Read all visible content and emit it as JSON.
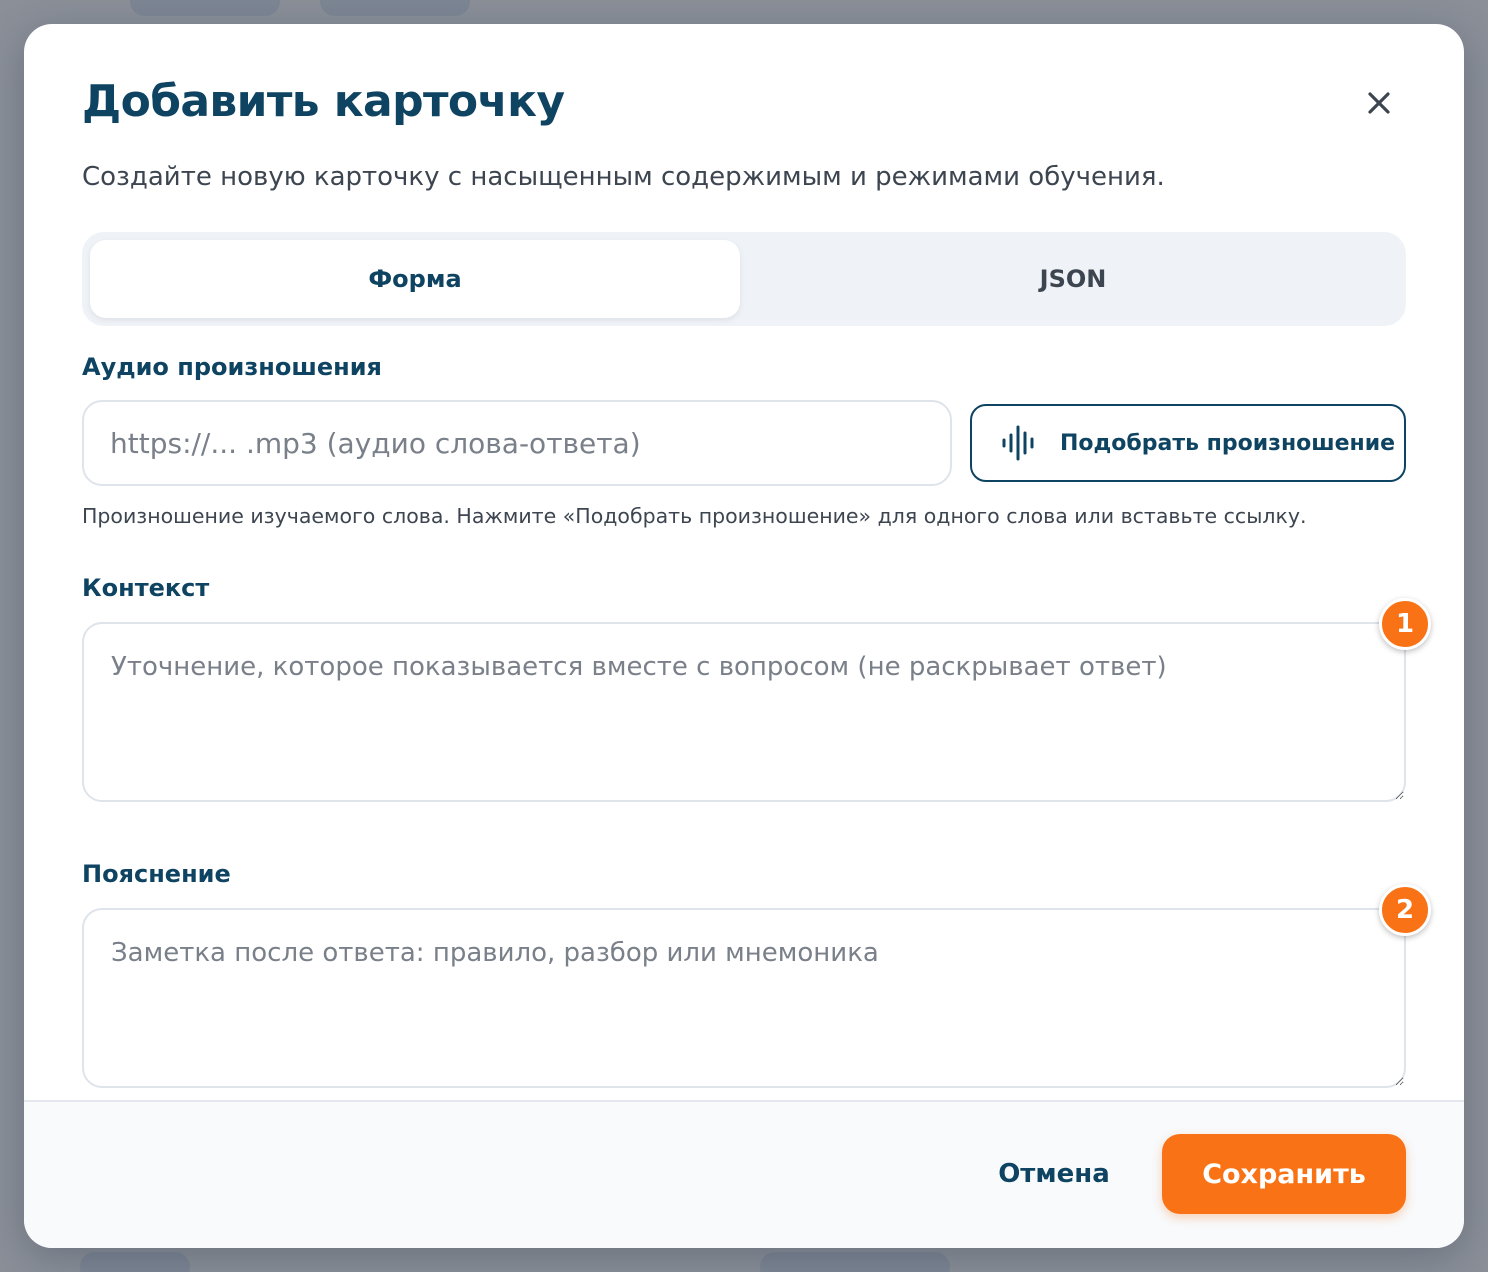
{
  "dialog": {
    "title": "Добавить карточку",
    "subtitle": "Создайте новую карточку с насыщенным содержимым и режимами обучения.",
    "close_icon": "close-icon"
  },
  "tabs": [
    {
      "label": "Форма",
      "active": true
    },
    {
      "label": "JSON",
      "active": false
    }
  ],
  "audio": {
    "label": "Аудио произношения",
    "placeholder": "https://... .mp3 (аудио слова-ответа)",
    "value": "",
    "button_label": "Подобрать произношение",
    "button_icon": "audio-waveform-icon",
    "helper": "Произношение изучаемого слова. Нажмите «Подобрать произношение» для одного слова или вставьте ссылку."
  },
  "context": {
    "label": "Контекст",
    "placeholder": "Уточнение, которое показывается вместе с вопросом (не раскрывает ответ)",
    "value": "",
    "badge": "1"
  },
  "explanation": {
    "label": "Пояснение",
    "placeholder": "Заметка после ответа: правило, разбор или мнемоника",
    "value": "",
    "badge": "2"
  },
  "footer": {
    "cancel_label": "Отмена",
    "save_label": "Сохранить"
  },
  "colors": {
    "primary": "#0e4361",
    "accent": "#f97316",
    "overlay": "#8a8f98"
  }
}
